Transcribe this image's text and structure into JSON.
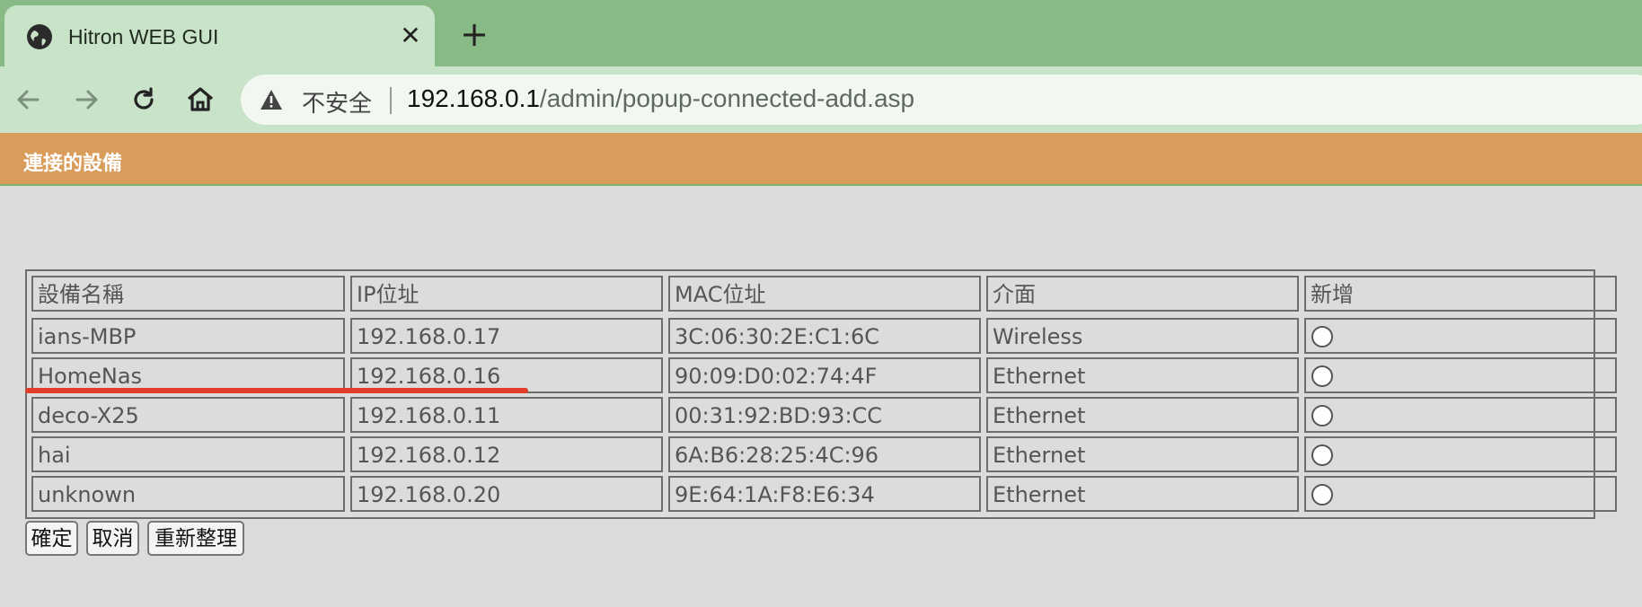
{
  "browser": {
    "tab_title": "Hitron WEB GUI",
    "close_label": "✕",
    "newtab_label": "+",
    "security_label": "不安全",
    "url_host": "192.168.0.1",
    "url_path": "/admin/popup-connected-add.asp"
  },
  "page": {
    "header_title": "連接的設備"
  },
  "table": {
    "headers": [
      "設備名稱",
      "IP位址",
      "MAC位址",
      "介面",
      "新增"
    ],
    "rows": [
      {
        "name": "ians-MBP",
        "ip": "192.168.0.17",
        "mac": "3C:06:30:2E:C1:6C",
        "iface": "Wireless",
        "selected": false
      },
      {
        "name": "HomeNas",
        "ip": "192.168.0.16",
        "mac": "90:09:D0:02:74:4F",
        "iface": "Ethernet",
        "selected": false
      },
      {
        "name": "deco-X25",
        "ip": "192.168.0.11",
        "mac": "00:31:92:BD:93:CC",
        "iface": "Ethernet",
        "selected": false
      },
      {
        "name": "hai",
        "ip": "192.168.0.12",
        "mac": "6A:B6:28:25:4C:96",
        "iface": "Ethernet",
        "selected": false
      },
      {
        "name": "unknown",
        "ip": "192.168.0.20",
        "mac": "9E:64:1A:F8:E6:34",
        "iface": "Ethernet",
        "selected": false
      }
    ]
  },
  "buttons": {
    "ok": "確定",
    "cancel": "取消",
    "refresh": "重新整理"
  },
  "colors": {
    "tabstrip": "#88ba85",
    "toolbar": "#c8e3c8",
    "header_band": "#d99c5b",
    "annotation_line": "#e23d28"
  }
}
